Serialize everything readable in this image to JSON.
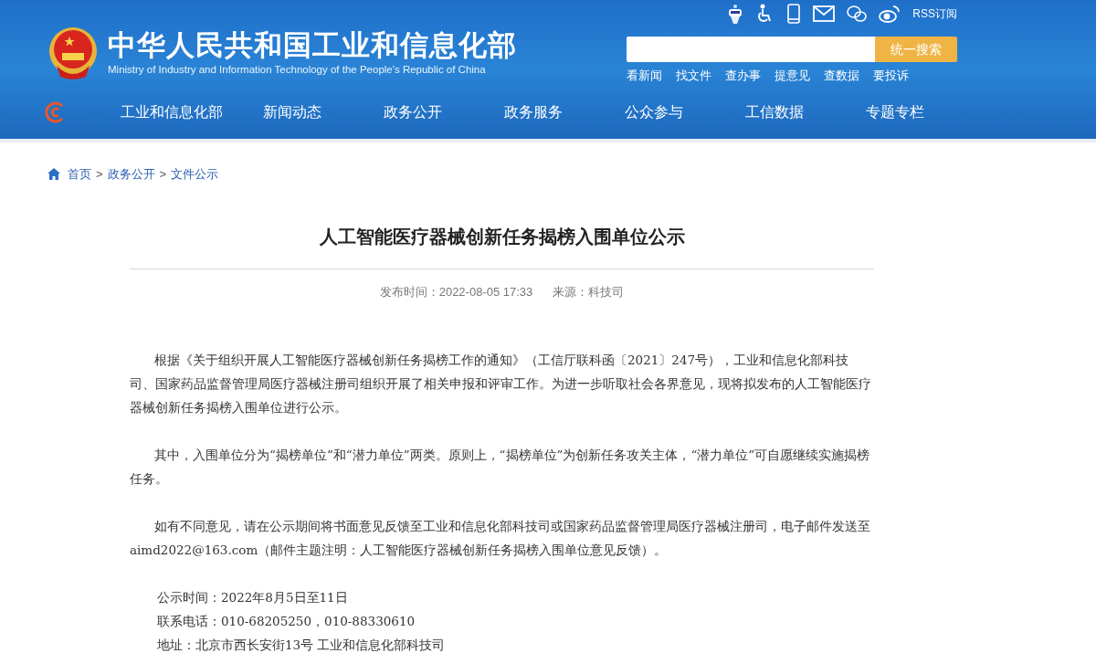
{
  "header": {
    "title": "中华人民共和国工业和信息化部",
    "subtitle": "Ministry of Industry and Information Technology of the People's Republic of China",
    "rss": "RSS订阅",
    "search": {
      "button": "统一搜索"
    },
    "quick_links": [
      "看新闻",
      "找文件",
      "查办事",
      "提意见",
      "查数据",
      "要投诉"
    ],
    "nav": [
      "工业和信息化部",
      "新闻动态",
      "政务公开",
      "政务服务",
      "公众参与",
      "工信数据",
      "专题专栏"
    ]
  },
  "breadcrumb": [
    "首页",
    "政务公开",
    "文件公示"
  ],
  "breadcrumb_separator": ">",
  "article": {
    "title": "人工智能医疗器械创新任务揭榜入围单位公示",
    "meta": [
      {
        "label": "发布时间：",
        "value": "2022-08-05 17:33"
      },
      {
        "label": "来源：",
        "value": "科技司"
      }
    ],
    "paragraphs": [
      "根据《关于组织开展人工智能医疗器械创新任务揭榜工作的通知》（工信厅联科函〔2021〕247号），工业和信息化部科技司、国家药品监督管理局医疗器械注册司组织开展了相关申报和评审工作。为进一步听取社会各界意见，现将拟发布的人工智能医疗器械创新任务揭榜入围单位进行公示。",
      "其中，入围单位分为“揭榜单位”和“潜力单位”两类。原则上，“揭榜单位”为创新任务攻关主体，“潜力单位”可自愿继续实施揭榜任务。",
      "如有不同意见，请在公示期间将书面意见反馈至工业和信息化部科技司或国家药品监督管理局医疗器械注册司，电子邮件发送至aimd2022@163.com（邮件主题注明：人工智能医疗器械创新任务揭榜入围单位意见反馈）。"
    ],
    "details": [
      "公示时间：2022年8月5日至11日",
      "联系电话：010-68205250，010-88330610",
      "地址：北京市西长安街13号 工业和信息化部科技司"
    ]
  }
}
